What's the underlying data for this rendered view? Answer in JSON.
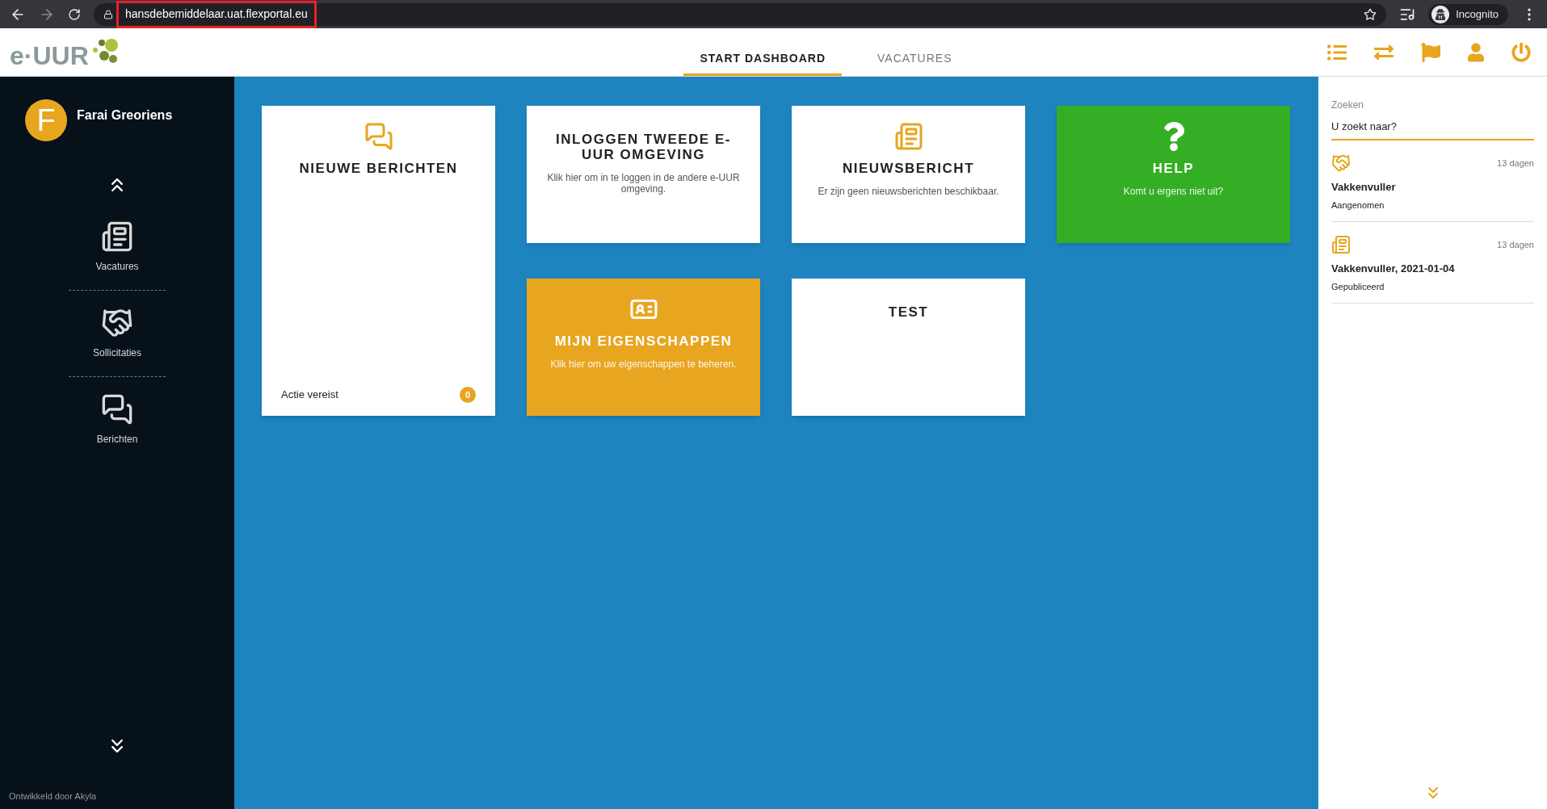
{
  "browser": {
    "url": "hansdebemiddelaar.uat.flexportal.eu",
    "profile": "Incognito"
  },
  "header": {
    "logo": "e·UUR",
    "tabs": [
      {
        "label": "START DASHBOARD",
        "selected": true
      },
      {
        "label": "VACATURES",
        "selected": false
      }
    ]
  },
  "sidebar": {
    "avatar_letter": "F",
    "user_name": "Farai Greoriens",
    "items": [
      {
        "label": "Vacatures",
        "kind": "news"
      },
      {
        "label": "Sollicitaties",
        "kind": "handshake"
      },
      {
        "label": "Berichten",
        "kind": "chat"
      }
    ],
    "footer": "Ontwikkeld door Akyla"
  },
  "cards": [
    {
      "kind": "chat",
      "title": "NIEUWE BERICHTEN",
      "color": "#ffffff",
      "footer": "Actie vereist",
      "count": "0"
    },
    {
      "kind": "plain",
      "title": "INLOGGEN TWEEDE E-UUR OMGEVING",
      "color": "#ffffff",
      "text": "Klik hier om in te loggen in de andere e-UUR omgeving."
    },
    {
      "kind": "news",
      "title": "NIEUWSBERICHT",
      "color": "#ffffff",
      "text": "Er zijn geen nieuwsberichten beschikbaar."
    },
    {
      "kind": "help",
      "title": "HELP",
      "color": "#34ae24",
      "text": "Komt u ergens niet uit?"
    },
    {
      "kind": "card",
      "title": "MIJN EIGENSCHAPPEN",
      "color": "#e8a51f",
      "text": "Klik hier om uw eigenschappen te beheren."
    },
    {
      "kind": "plain",
      "title": "TEST",
      "color": "#ffffff"
    }
  ],
  "right_panel": {
    "search": {
      "label": "Zoeken",
      "placeholder": "U zoekt naar?"
    },
    "items": [
      {
        "kind": "handshake",
        "age": "13 dagen",
        "title": "Vakkenvuller",
        "status": "Aangenomen"
      },
      {
        "kind": "news",
        "age": "13 dagen",
        "title": "Vakkenvuller, 2021-01-04",
        "status": "Gepubliceerd"
      }
    ]
  }
}
